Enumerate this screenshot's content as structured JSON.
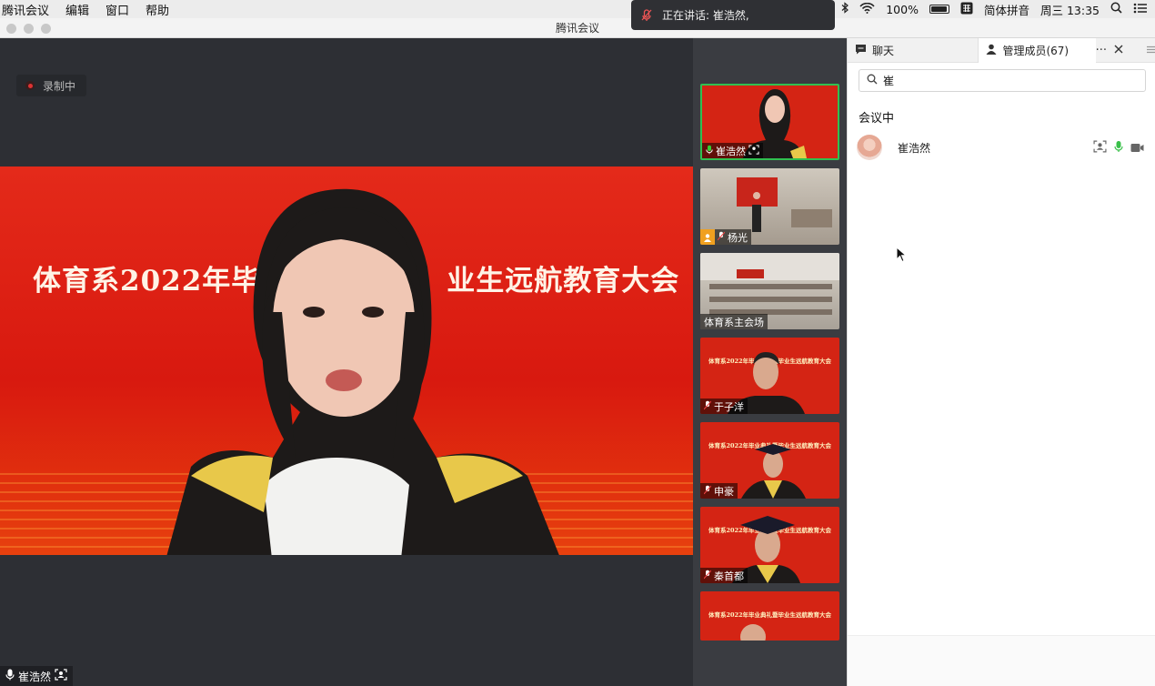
{
  "menubar": {
    "menus": [
      "腾讯会议",
      "编辑",
      "窗口",
      "帮助"
    ],
    "battery": "100%",
    "input_method": "简体拼音",
    "clock": "周三 13:35"
  },
  "speaking_banner": {
    "label": "正在讲话: 崔浩然,"
  },
  "window": {
    "title": "腾讯会议"
  },
  "main": {
    "recording_label": "录制中",
    "banner_text": "体育系2022年毕业典礼暨毕业生远航教育大会",
    "banner_visible_left": "体育系2022年毕",
    "banner_visible_right": "业生远航教育大会",
    "speaker_name": "崔浩然"
  },
  "thumbnails": [
    {
      "name": "崔浩然",
      "type": "person-red",
      "active": true
    },
    {
      "name": "杨光",
      "type": "stage",
      "active": false
    },
    {
      "name": "体育系主会场",
      "type": "room",
      "active": false
    },
    {
      "name": "于子洋",
      "type": "person-red",
      "active": false,
      "banner": "体育系2022年毕业典礼暨毕业生远航教育大会"
    },
    {
      "name": "申豪",
      "type": "person-red",
      "active": false,
      "banner": "体育系2022年毕业典礼暨毕业生远航教育大会"
    },
    {
      "name": "秦首都",
      "type": "person-red",
      "active": false,
      "banner": "体育系2022年毕业典礼暨毕业生远航教育大会"
    },
    {
      "name": "",
      "type": "person-red",
      "active": false,
      "banner": "体育系2022年毕业典礼暨毕业生远航教育大会"
    }
  ],
  "panel": {
    "tab_chat": "聊天",
    "tab_members": "管理成员(67)",
    "search_value": "崔",
    "section_title": "会议中",
    "members": [
      {
        "name": "崔浩然"
      }
    ]
  },
  "colors": {
    "accent_green": "#30c050",
    "banner_red": "#d8190f"
  }
}
